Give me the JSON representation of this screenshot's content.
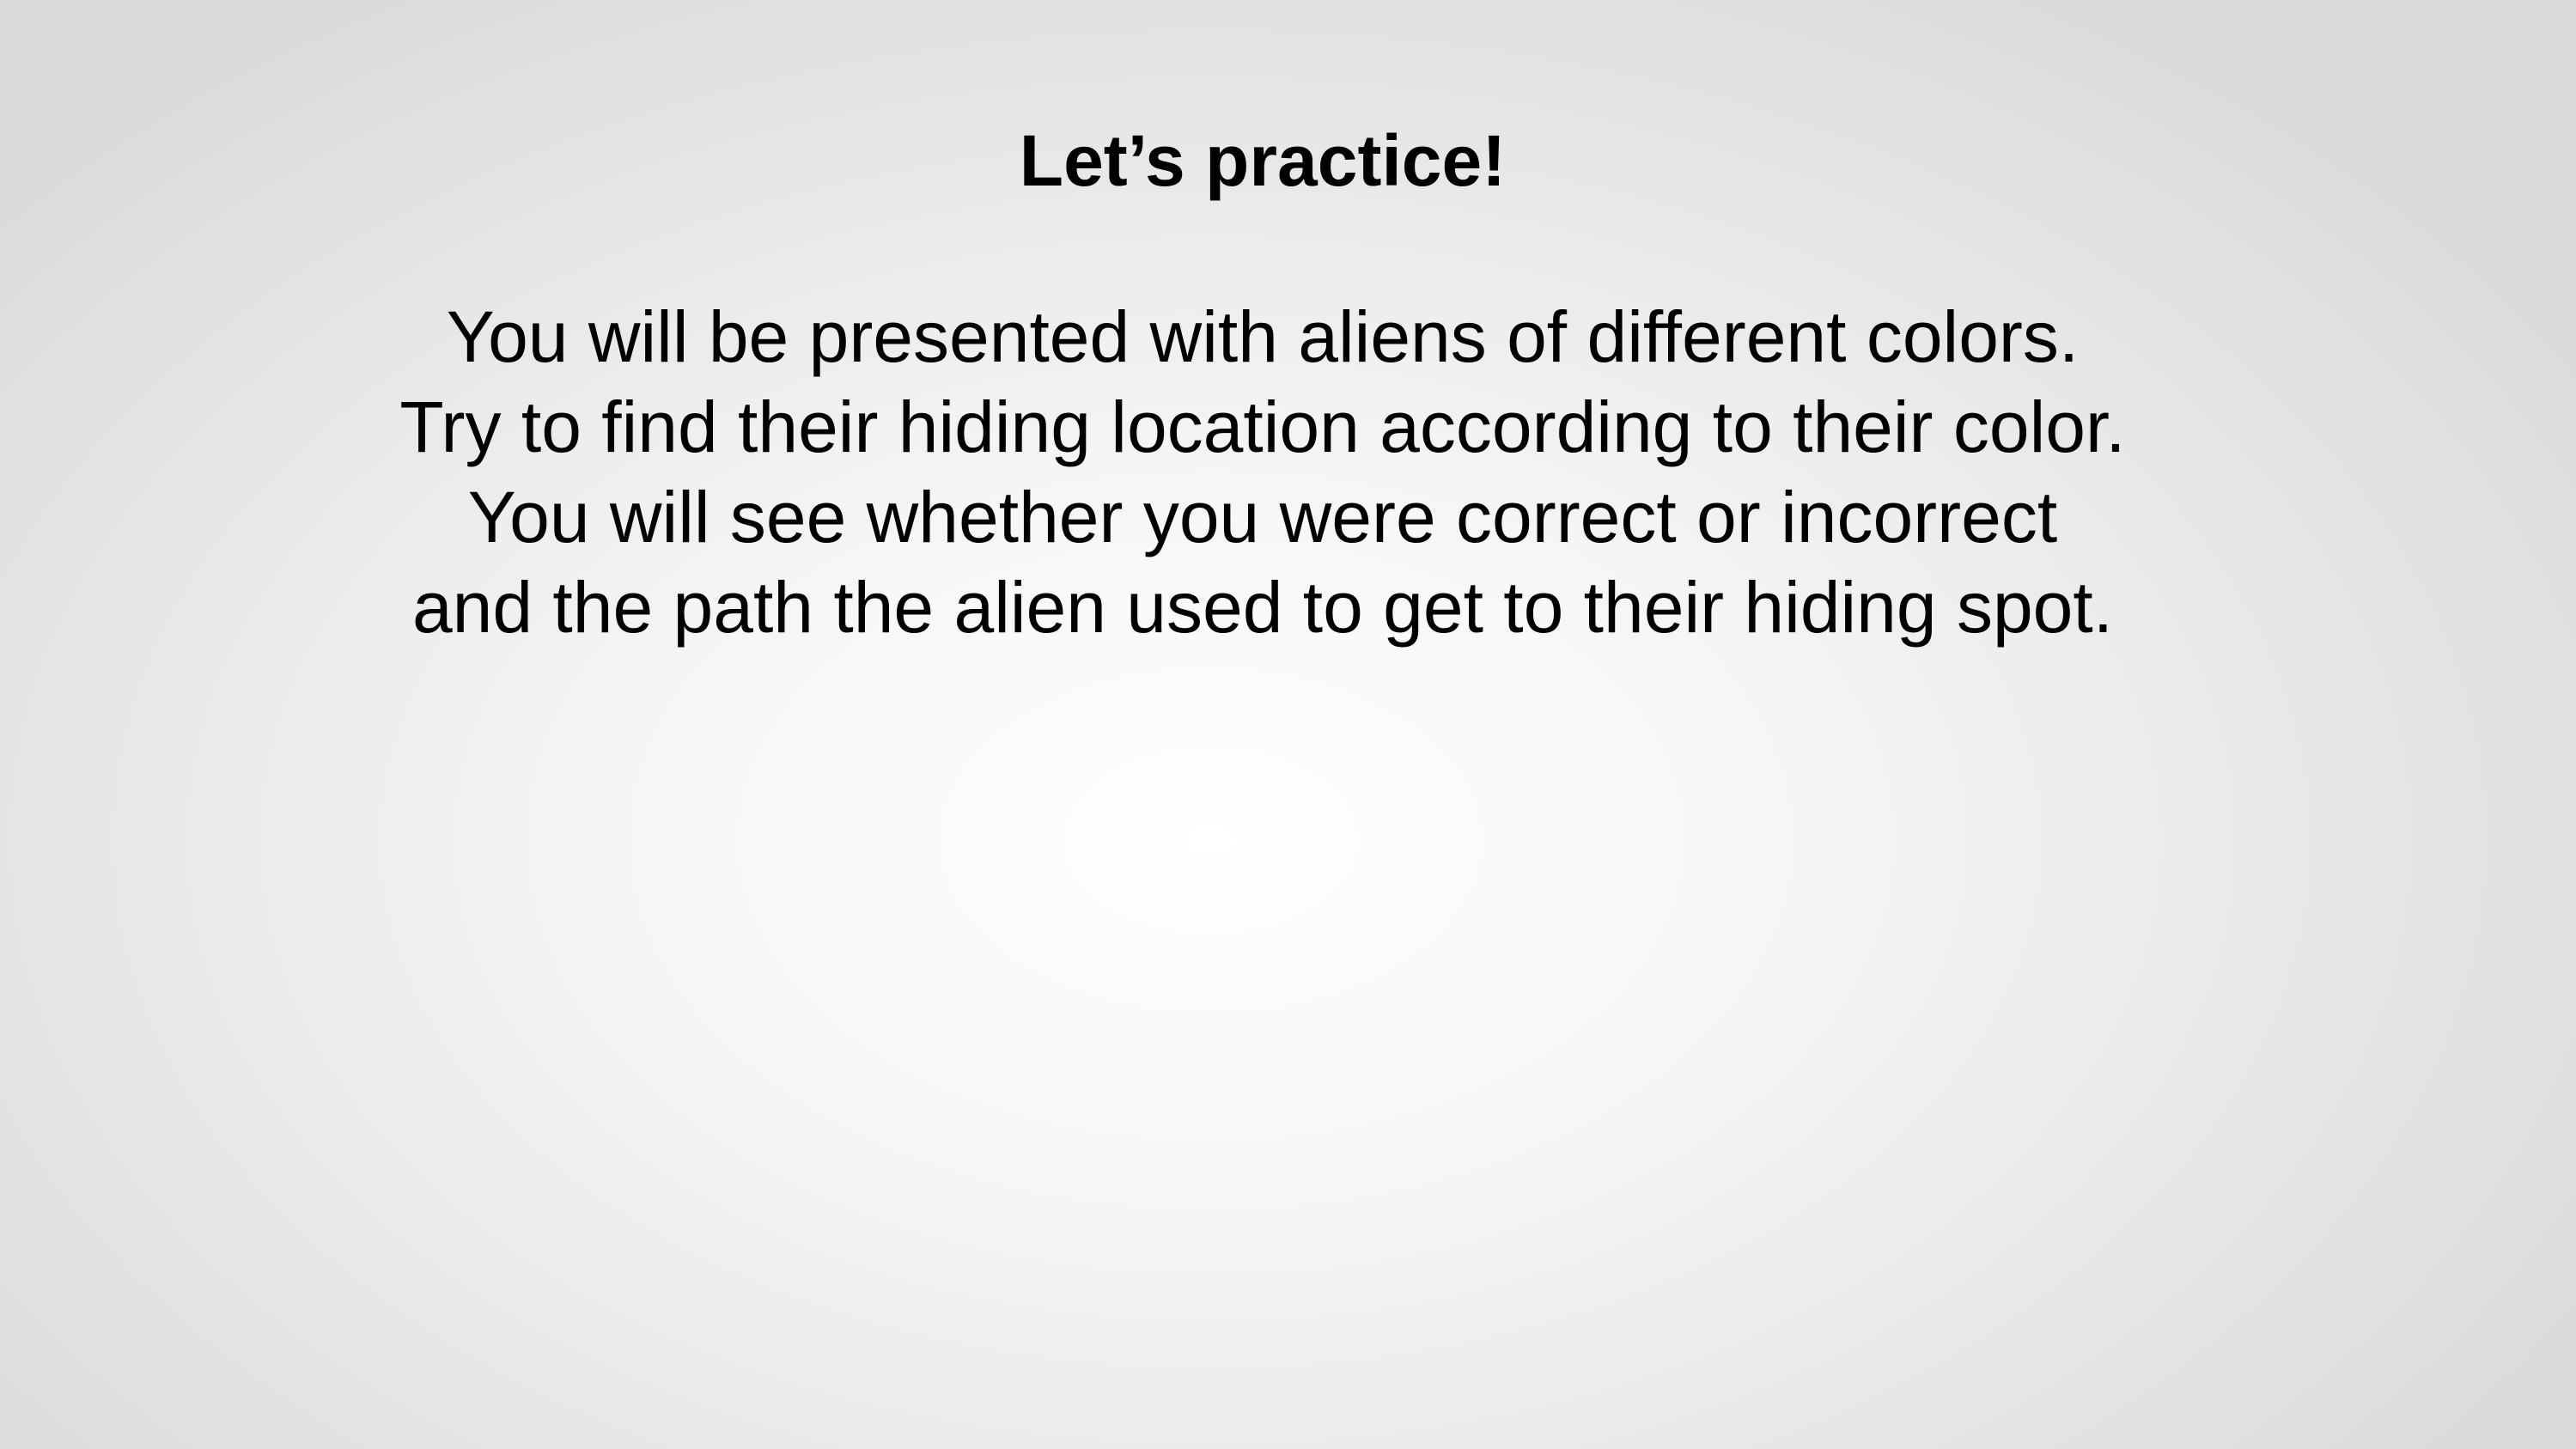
{
  "slide": {
    "title": "Let’s practice!",
    "body_lines": [
      "You will be presented with aliens of different colors.",
      "Try to find their hiding location according to their color.",
      "You will see whether you were correct or incorrect",
      "and the path the alien used to get to their hiding spot."
    ]
  },
  "colors": {
    "text": "#000000",
    "background_center": "#ffffff",
    "background_edge": "#dadada"
  }
}
